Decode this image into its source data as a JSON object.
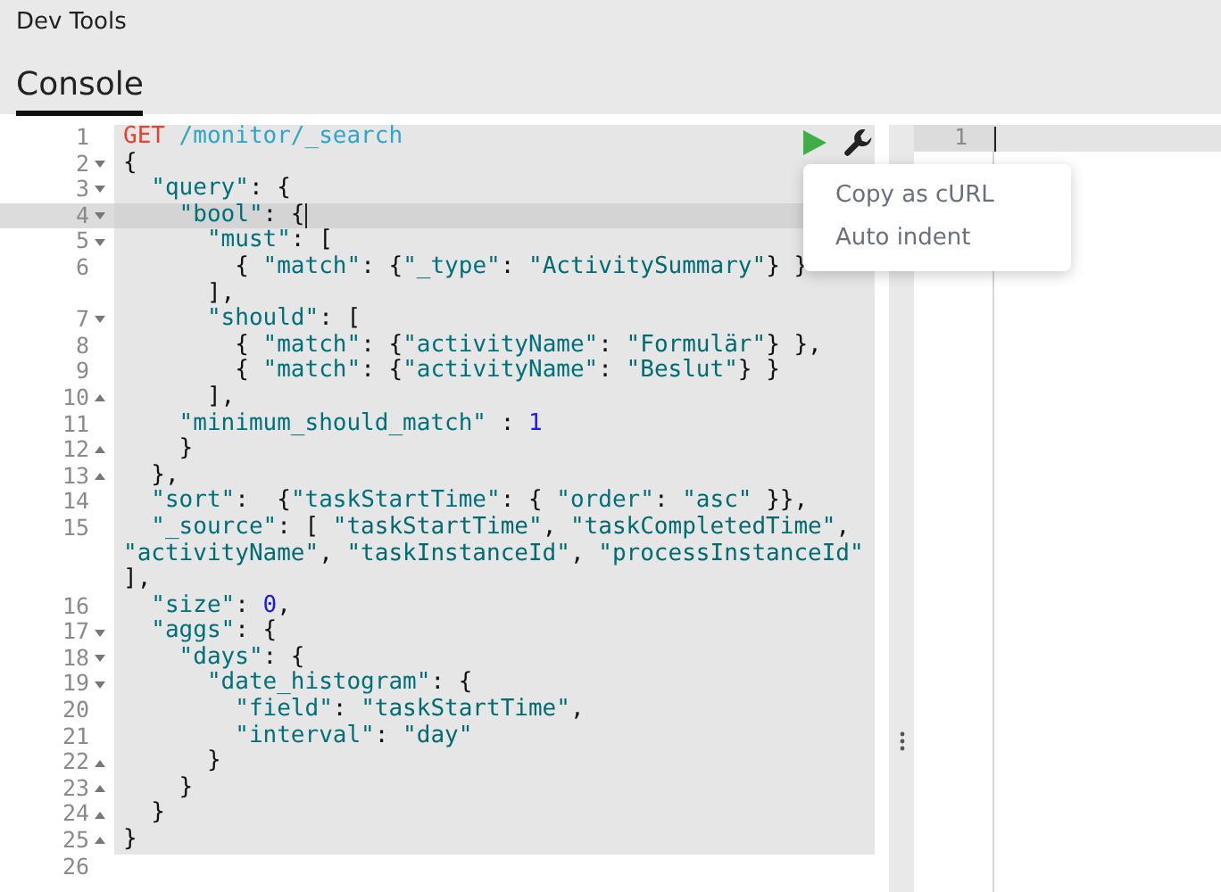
{
  "app_title": "Dev Tools",
  "tabs": [
    {
      "label": "Console",
      "selected": true
    }
  ],
  "editor": {
    "rows": [
      {
        "number": "1",
        "selected": true,
        "tokens": [
          {
            "kind": "method",
            "text": "GET"
          },
          {
            "kind": "path",
            "text": " /monitor/_search"
          }
        ]
      },
      {
        "number": "2",
        "fold_start": true,
        "selected": true,
        "tokens": [
          {
            "kind": "punct",
            "text": "{"
          }
        ]
      },
      {
        "number": "3",
        "fold_start": true,
        "selected": true,
        "tokens": [
          {
            "kind": "key",
            "text": "  \"query\""
          },
          {
            "kind": "punct",
            "text": ": {"
          }
        ]
      },
      {
        "number": "4",
        "fold_start": true,
        "selected": true,
        "active": true,
        "tokens": [
          {
            "kind": "key",
            "text": "    \"bool\""
          },
          {
            "kind": "punct",
            "text": ": {"
          }
        ]
      },
      {
        "number": "5",
        "fold_start": true,
        "selected": true,
        "tokens": [
          {
            "kind": "key",
            "text": "      \"must\""
          },
          {
            "kind": "punct",
            "text": ": ["
          }
        ]
      },
      {
        "number": "6",
        "selected": true,
        "tokens": [
          {
            "kind": "punct",
            "text": "        { "
          },
          {
            "kind": "key",
            "text": "\"match\""
          },
          {
            "kind": "punct",
            "text": ": {"
          },
          {
            "kind": "key",
            "text": "\"_type\""
          },
          {
            "kind": "punct",
            "text": ": "
          },
          {
            "kind": "string",
            "text": "\"ActivitySummary\""
          },
          {
            "kind": "punct",
            "text": "} }"
          }
        ]
      },
      {
        "selected": true,
        "tokens": [
          {
            "kind": "punct",
            "text": "      ],"
          }
        ]
      },
      {
        "number": "7",
        "fold_start": true,
        "selected": true,
        "tokens": [
          {
            "kind": "key",
            "text": "      \"should\""
          },
          {
            "kind": "punct",
            "text": ": ["
          }
        ]
      },
      {
        "number": "8",
        "selected": true,
        "tokens": [
          {
            "kind": "punct",
            "text": "        { "
          },
          {
            "kind": "key",
            "text": "\"match\""
          },
          {
            "kind": "punct",
            "text": ": {"
          },
          {
            "kind": "key",
            "text": "\"activityName\""
          },
          {
            "kind": "punct",
            "text": ": "
          },
          {
            "kind": "string",
            "text": "\"Formulär\""
          },
          {
            "kind": "punct",
            "text": "} },"
          }
        ]
      },
      {
        "number": "9",
        "selected": true,
        "tokens": [
          {
            "kind": "punct",
            "text": "        { "
          },
          {
            "kind": "key",
            "text": "\"match\""
          },
          {
            "kind": "punct",
            "text": ": {"
          },
          {
            "kind": "key",
            "text": "\"activityName\""
          },
          {
            "kind": "punct",
            "text": ": "
          },
          {
            "kind": "string",
            "text": "\"Beslut\""
          },
          {
            "kind": "punct",
            "text": "} }"
          }
        ]
      },
      {
        "number": "10",
        "fold_end": true,
        "selected": true,
        "tokens": [
          {
            "kind": "punct",
            "text": "      ],"
          }
        ]
      },
      {
        "number": "11",
        "selected": true,
        "tokens": [
          {
            "kind": "key",
            "text": "    \"minimum_should_match\""
          },
          {
            "kind": "punct",
            "text": " : "
          },
          {
            "kind": "number",
            "text": "1"
          }
        ]
      },
      {
        "number": "12",
        "fold_end": true,
        "selected": true,
        "tokens": [
          {
            "kind": "punct",
            "text": "    }"
          }
        ]
      },
      {
        "number": "13",
        "fold_end": true,
        "selected": true,
        "tokens": [
          {
            "kind": "punct",
            "text": "  },"
          }
        ]
      },
      {
        "number": "14",
        "selected": true,
        "tokens": [
          {
            "kind": "key",
            "text": "  \"sort\""
          },
          {
            "kind": "punct",
            "text": ":  {"
          },
          {
            "kind": "key",
            "text": "\"taskStartTime\""
          },
          {
            "kind": "punct",
            "text": ": { "
          },
          {
            "kind": "key",
            "text": "\"order\""
          },
          {
            "kind": "punct",
            "text": ": "
          },
          {
            "kind": "string",
            "text": "\"asc\""
          },
          {
            "kind": "punct",
            "text": " }},"
          }
        ]
      },
      {
        "number": "15",
        "selected": true,
        "tokens": [
          {
            "kind": "key",
            "text": "  \"_source\""
          },
          {
            "kind": "punct",
            "text": ": [ "
          },
          {
            "kind": "string",
            "text": "\"taskStartTime\""
          },
          {
            "kind": "punct",
            "text": ", "
          },
          {
            "kind": "string",
            "text": "\"taskCompletedTime\""
          },
          {
            "kind": "punct",
            "text": ","
          }
        ]
      },
      {
        "selected": true,
        "tokens": [
          {
            "kind": "string",
            "text": "\"activityName\""
          },
          {
            "kind": "punct",
            "text": ", "
          },
          {
            "kind": "string",
            "text": "\"taskInstanceId\""
          },
          {
            "kind": "punct",
            "text": ", "
          },
          {
            "kind": "string",
            "text": "\"processInstanceId\""
          }
        ]
      },
      {
        "selected": true,
        "tokens": [
          {
            "kind": "punct",
            "text": "],"
          }
        ]
      },
      {
        "number": "16",
        "selected": true,
        "tokens": [
          {
            "kind": "key",
            "text": "  \"size\""
          },
          {
            "kind": "punct",
            "text": ": "
          },
          {
            "kind": "number",
            "text": "0"
          },
          {
            "kind": "punct",
            "text": ","
          }
        ]
      },
      {
        "number": "17",
        "fold_start": true,
        "selected": true,
        "tokens": [
          {
            "kind": "key",
            "text": "  \"aggs\""
          },
          {
            "kind": "punct",
            "text": ": {"
          }
        ]
      },
      {
        "number": "18",
        "fold_start": true,
        "selected": true,
        "tokens": [
          {
            "kind": "key",
            "text": "    \"days\""
          },
          {
            "kind": "punct",
            "text": ": {"
          }
        ]
      },
      {
        "number": "19",
        "fold_start": true,
        "selected": true,
        "tokens": [
          {
            "kind": "key",
            "text": "      \"date_histogram\""
          },
          {
            "kind": "punct",
            "text": ": {"
          }
        ]
      },
      {
        "number": "20",
        "selected": true,
        "tokens": [
          {
            "kind": "key",
            "text": "        \"field\""
          },
          {
            "kind": "punct",
            "text": ": "
          },
          {
            "kind": "string",
            "text": "\"taskStartTime\""
          },
          {
            "kind": "punct",
            "text": ","
          }
        ]
      },
      {
        "number": "21",
        "selected": true,
        "tokens": [
          {
            "kind": "key",
            "text": "        \"interval\""
          },
          {
            "kind": "punct",
            "text": ": "
          },
          {
            "kind": "string",
            "text": "\"day\""
          }
        ]
      },
      {
        "number": "22",
        "fold_end": true,
        "selected": true,
        "tokens": [
          {
            "kind": "punct",
            "text": "      }"
          }
        ]
      },
      {
        "number": "23",
        "fold_end": true,
        "selected": true,
        "tokens": [
          {
            "kind": "punct",
            "text": "    }"
          }
        ]
      },
      {
        "number": "24",
        "fold_end": true,
        "selected": true,
        "tokens": [
          {
            "kind": "punct",
            "text": "  }"
          }
        ]
      },
      {
        "number": "25",
        "fold_end": true,
        "selected": true,
        "tokens": [
          {
            "kind": "punct",
            "text": "}"
          }
        ]
      },
      {
        "number": "26",
        "selected": false
      }
    ]
  },
  "context_menu": {
    "items": [
      "Copy as cURL",
      "Auto indent"
    ]
  },
  "output": {
    "rows": [
      {
        "number": "1",
        "active": true
      }
    ]
  }
}
